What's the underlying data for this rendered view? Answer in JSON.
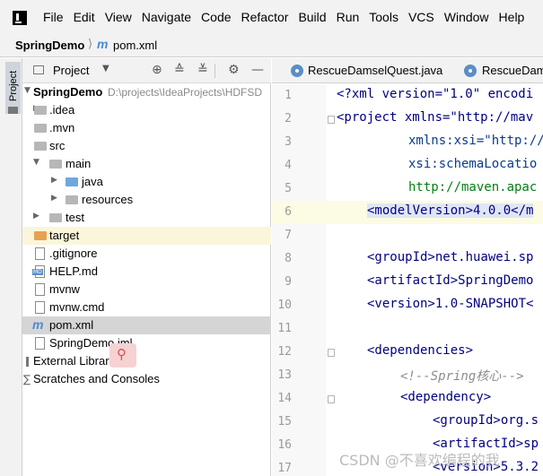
{
  "menubar": {
    "items": [
      "File",
      "Edit",
      "View",
      "Navigate",
      "Code",
      "Refactor",
      "Build",
      "Run",
      "Tools",
      "VCS",
      "Window",
      "Help"
    ]
  },
  "navbar": {
    "project": "SpringDemo",
    "file": "pom.xml"
  },
  "left_strip": {
    "project_label": "Project"
  },
  "project_panel": {
    "title": "Project",
    "tree": [
      {
        "label": "SpringDemo",
        "path": "D:\\projects\\IdeaProjects\\HDFSD",
        "bold": true
      },
      {
        "label": ".idea"
      },
      {
        "label": ".mvn"
      },
      {
        "label": "src"
      },
      {
        "label": "main"
      },
      {
        "label": "java"
      },
      {
        "label": "resources"
      },
      {
        "label": "test"
      },
      {
        "label": "target"
      },
      {
        "label": ".gitignore"
      },
      {
        "label": "HELP.md"
      },
      {
        "label": "mvnw"
      },
      {
        "label": "mvnw.cmd"
      },
      {
        "label": "pom.xml"
      },
      {
        "label": "SpringDemo.iml"
      },
      {
        "label": "External Libraries"
      },
      {
        "label": "Scratches and Consoles"
      }
    ]
  },
  "tabs": [
    {
      "label": "RescueDamselQuest.java"
    },
    {
      "label": "RescueDam"
    }
  ],
  "editor": {
    "line_numbers": [
      "1",
      "2",
      "3",
      "4",
      "5",
      "6",
      "7",
      "8",
      "9",
      "10",
      "11",
      "12",
      "13",
      "14",
      "15",
      "16",
      "17"
    ],
    "lines": [
      "<?xml version=\"1.0\" encodi",
      "<project xmlns=\"http://mav",
      "xmlns:xsi=\"http://",
      "xsi:schemaLocatio",
      "http://maven.apac",
      "<modelVersion>4.0.0</m",
      "",
      "<groupId>net.huawei.sp",
      "<artifactId>SpringDemo",
      "<version>1.0-SNAPSHOT<",
      "",
      "<dependencies>",
      "<!--Spring核心-->",
      "<dependency>",
      "<groupId>org.s",
      "<artifactId>sp",
      "<version>5.3.2"
    ]
  },
  "watermark": "CSDN @不喜欢编程的我"
}
